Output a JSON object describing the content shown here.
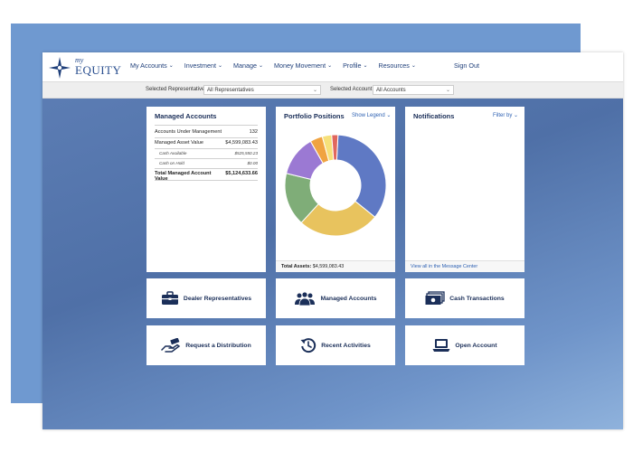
{
  "brand": {
    "logo_my": "my",
    "logo_equity": "EQUITY"
  },
  "nav": {
    "items": [
      {
        "label": "My Accounts"
      },
      {
        "label": "Investment"
      },
      {
        "label": "Manage"
      },
      {
        "label": "Money Movement"
      },
      {
        "label": "Profile"
      },
      {
        "label": "Resources"
      }
    ],
    "signout": "Sign Out"
  },
  "filters": {
    "rep_label": "Selected Representative",
    "rep_value": "All Representatives",
    "account_label": "Selected Account",
    "account_value": "All Accounts"
  },
  "managed_accounts": {
    "title": "Managed Accounts",
    "rows": [
      {
        "label": "Accounts Under Management",
        "value": "132"
      },
      {
        "label": "Managed Asset Value",
        "value": "$4,599,083.43"
      },
      {
        "label": "Cash Available",
        "value": "$525,550.23"
      },
      {
        "label": "Cash on Hold",
        "value": "$0.00"
      },
      {
        "label": "Total Managed Account Value",
        "value": "$5,124,633.66"
      }
    ]
  },
  "portfolio": {
    "title": "Portfolio Positions",
    "show_legend": "Show Legend",
    "footer_label": "Total Assets:",
    "footer_value": "$4,599,083.43"
  },
  "notifications": {
    "title": "Notifications",
    "filter": "Filter by",
    "footer_link": "View all in the Message Center"
  },
  "actions": [
    {
      "label": "Dealer Representatives",
      "icon": "briefcase-icon"
    },
    {
      "label": "Managed Accounts",
      "icon": "group-icon"
    },
    {
      "label": "Cash Transactions",
      "icon": "cash-icon"
    },
    {
      "label": "Request a Distribution",
      "icon": "hand-money-icon"
    },
    {
      "label": "Recent Activities",
      "icon": "clock-refresh-icon"
    },
    {
      "label": "Open Account",
      "icon": "laptop-icon"
    }
  ],
  "chart_data": {
    "type": "pie",
    "style": "donut",
    "slices": [
      {
        "value": 35,
        "color": "#5f79c4"
      },
      {
        "value": 26,
        "color": "#e8c35e"
      },
      {
        "value": 17,
        "color": "#7fad78"
      },
      {
        "value": 13,
        "color": "#9b79d3"
      },
      {
        "value": 4,
        "color": "#f0a341"
      },
      {
        "value": 3,
        "color": "#f6e07a"
      },
      {
        "value": 2,
        "color": "#e0675d"
      }
    ]
  },
  "colors": {
    "brand_navy": "#1b2f59",
    "link_blue": "#2f62b3",
    "background_blue": "#5e7fb6"
  }
}
